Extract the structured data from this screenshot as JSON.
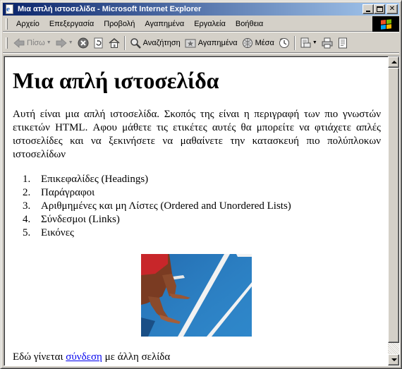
{
  "window": {
    "title": "Μια απλή ιστοσελίδα - Microsoft Internet Explorer"
  },
  "menubar": {
    "items": [
      "Αρχείο",
      "Επεξεργασία",
      "Προβολή",
      "Αγαπημένα",
      "Εργαλεία",
      "Βοήθεια"
    ]
  },
  "toolbar": {
    "back_label": "Πίσω",
    "search_label": "Αναζήτηση",
    "favorites_label": "Αγαπημένα",
    "media_label": "Μέσα"
  },
  "page": {
    "heading": "Μια απλή ιστοσελίδα",
    "intro": "Αυτή είναι μια απλή ιστοσελίδα. Σκοπός της είναι η περιγραφή των πιο γνωστών ετικετών HTML. Αφου μάθετε τις ετικέτες αυτές θα μπορείτε να φτιάχετε απλές ιστοσελίδες και να ξεκινήσετε να μαθαίνετε την κατασκευή πιο πολύπλοκων ιστοσελίδων",
    "list": [
      {
        "num": "1.",
        "text": "Επικεφαλίδες (Headings)"
      },
      {
        "num": "2.",
        "text": "Παράγραφοι"
      },
      {
        "num": "3.",
        "text": "Αριθμημένες και μη Λίστες (Ordered and Unordered Lists)"
      },
      {
        "num": "4.",
        "text": "Σύνδεσμοι (Links)"
      },
      {
        "num": "5.",
        "text": "Εικόνες"
      }
    ],
    "footer_before": "Εδώ γίνεται ",
    "footer_link": "σύνδεση",
    "footer_after": " με άλλη σελίδα"
  },
  "colors": {
    "titlebar_start": "#0a246a",
    "titlebar_end": "#a6caf0",
    "link": "#0000ee",
    "chrome": "#d4d0c8"
  }
}
